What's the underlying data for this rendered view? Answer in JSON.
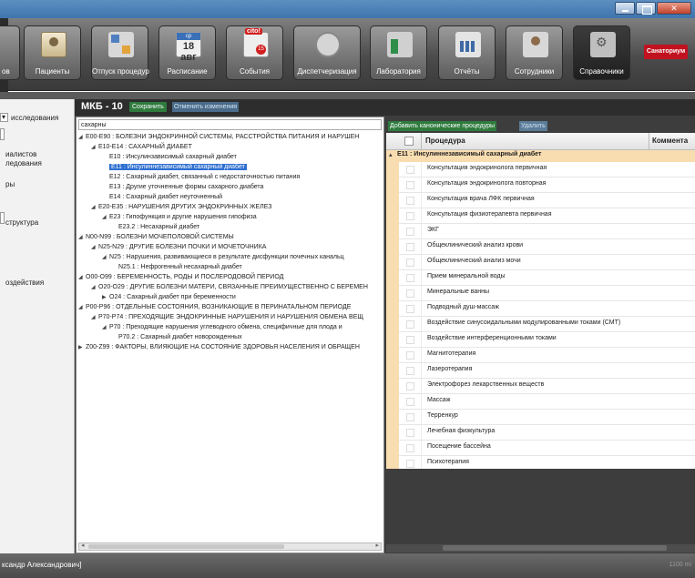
{
  "toolbar": {
    "partial_label": "ов",
    "buttons": [
      {
        "label": "Пациенты",
        "icon": "patients-icon"
      },
      {
        "label": "Отпуск процедур",
        "icon": "procedures-icon"
      },
      {
        "label": "Расписание",
        "icon": "calendar-icon"
      },
      {
        "label": "События",
        "icon": "events-icon"
      },
      {
        "label": "Диспетчеризация",
        "icon": "dispatch-icon"
      },
      {
        "label": "Лаборатория",
        "icon": "laboratory-icon"
      },
      {
        "label": "Отчёты",
        "icon": "reports-icon"
      },
      {
        "label": "Сотрудники",
        "icon": "staff-icon"
      },
      {
        "label": "Справочники",
        "icon": "reference-icon"
      }
    ],
    "calendar_header": "ср",
    "calendar_day": "18 авг",
    "events_badge": "cito!",
    "events_count": "15",
    "sanatorium": "Санаториум"
  },
  "leftpane": {
    "items": [
      "исследования",
      "иалистов",
      "ледования",
      "ры",
      "структура",
      "оздействия"
    ]
  },
  "mkb": {
    "title": "МКБ - 10",
    "save_label": "Сохранить",
    "cancel_label": "Отменить изменения",
    "search_value": "сахарны",
    "tree": [
      "E00-E90 : БОЛЕЗНИ ЭНДОКРИННОЙ СИСТЕМЫ, РАССТРОЙСТВА ПИТАНИЯ И НАРУШЕН",
      "E10-E14 : САХАРНЫЙ ДИАБЕТ",
      "E10 : Инсулинзависимый сахарный диабет",
      "E11 : Инсулиннезависимый сахарный диабет",
      "E12 : Сахарный диабет, связанный с недостаточностью питания",
      "E13 : Другие уточненные формы сахарного диабета",
      "E14 : Сахарный диабет неуточненный",
      "E20-E35 : НАРУШЕНИЯ ДРУГИХ ЭНДОКРИННЫХ ЖЕЛЕЗ",
      "E23 : Гипофункция и другие нарушения гипофиза",
      "E23.2 : Несахарный диабет",
      "N00-N99 : БОЛЕЗНИ МОЧЕПОЛОВОЙ СИСТЕМЫ",
      "N25-N29 : ДРУГИЕ БОЛЕЗНИ ПОЧКИ И МОЧЕТОЧНИКА",
      "N25 : Нарушения, развивающиеся в результате дисфункции почечных канальц",
      "N25.1 : Нефрогенный несахарный диабет",
      "O00-O99 : БЕРЕМЕННОСТЬ, РОДЫ И ПОСЛЕРОДОВОЙ ПЕРИОД",
      "O20-O29 : ДРУГИЕ БОЛЕЗНИ МАТЕРИ, СВЯЗАННЫЕ ПРЕИМУЩЕСТВЕННО С БЕРЕМЕН",
      "O24 : Сахарный диабет при беременности",
      "P00-P96 : ОТДЕЛЬНЫЕ СОСТОЯНИЯ, ВОЗНИКАЮЩИЕ В ПЕРИНАТАЛЬНОМ ПЕРИОДЕ",
      "P70-P74 : ПРЕХОДЯЩИЕ ЭНДОКРИННЫЕ НАРУШЕНИЯ И НАРУШЕНИЯ ОБМЕНА ВЕЩ",
      "P70 : Преходящие нарушения углеводного обмена, специфичные для плода и",
      "P70.2 : Сахарный диабет новорожденных",
      "Z00-Z99 : ФАКТОРЫ, ВЛИЯЮЩИЕ НА СОСТОЯНИЕ ЗДОРОВЬЯ НАСЕЛЕНИЯ И ОБРАЩЕН"
    ]
  },
  "procedures": {
    "add_label": "Добавить канонические процедуры",
    "delete_label": "Удалить",
    "col_procedure": "Процедура",
    "col_comment": "Коммента",
    "group": "E11 : Инсулиннезависимый сахарный диабет",
    "rows": [
      "Консультация эндокринолога первичная",
      "Консультация эндокринолога повторная",
      "Консультация врача ЛФК первичная",
      "Консультация физиотерапевта первичная",
      "ЭКГ",
      "Общеклинический анализ крови",
      "Общеклинический анализ мочи",
      "Прием минеральной воды",
      "Минеральные ванны",
      "Подводный душ-массаж",
      "Воздействие синусоидальными модулированными токами (СМТ)",
      "Воздействие интерференционными токами",
      "Магнитотерапия",
      "Лазеротерапия",
      "Электрофорез лекарственных веществ",
      "Массаж",
      "Терренкур",
      "Лечебная физкультура",
      "Посещение бассейна",
      "Психотерапия"
    ]
  },
  "status": {
    "user": "ксандр Александрович]",
    "size": "1100 mi"
  },
  "colors": {
    "selected": "#2f6fd1",
    "group_row": "#f8ddb0",
    "save_green": "#2f7b3e",
    "brand_red": "#c1121f"
  }
}
